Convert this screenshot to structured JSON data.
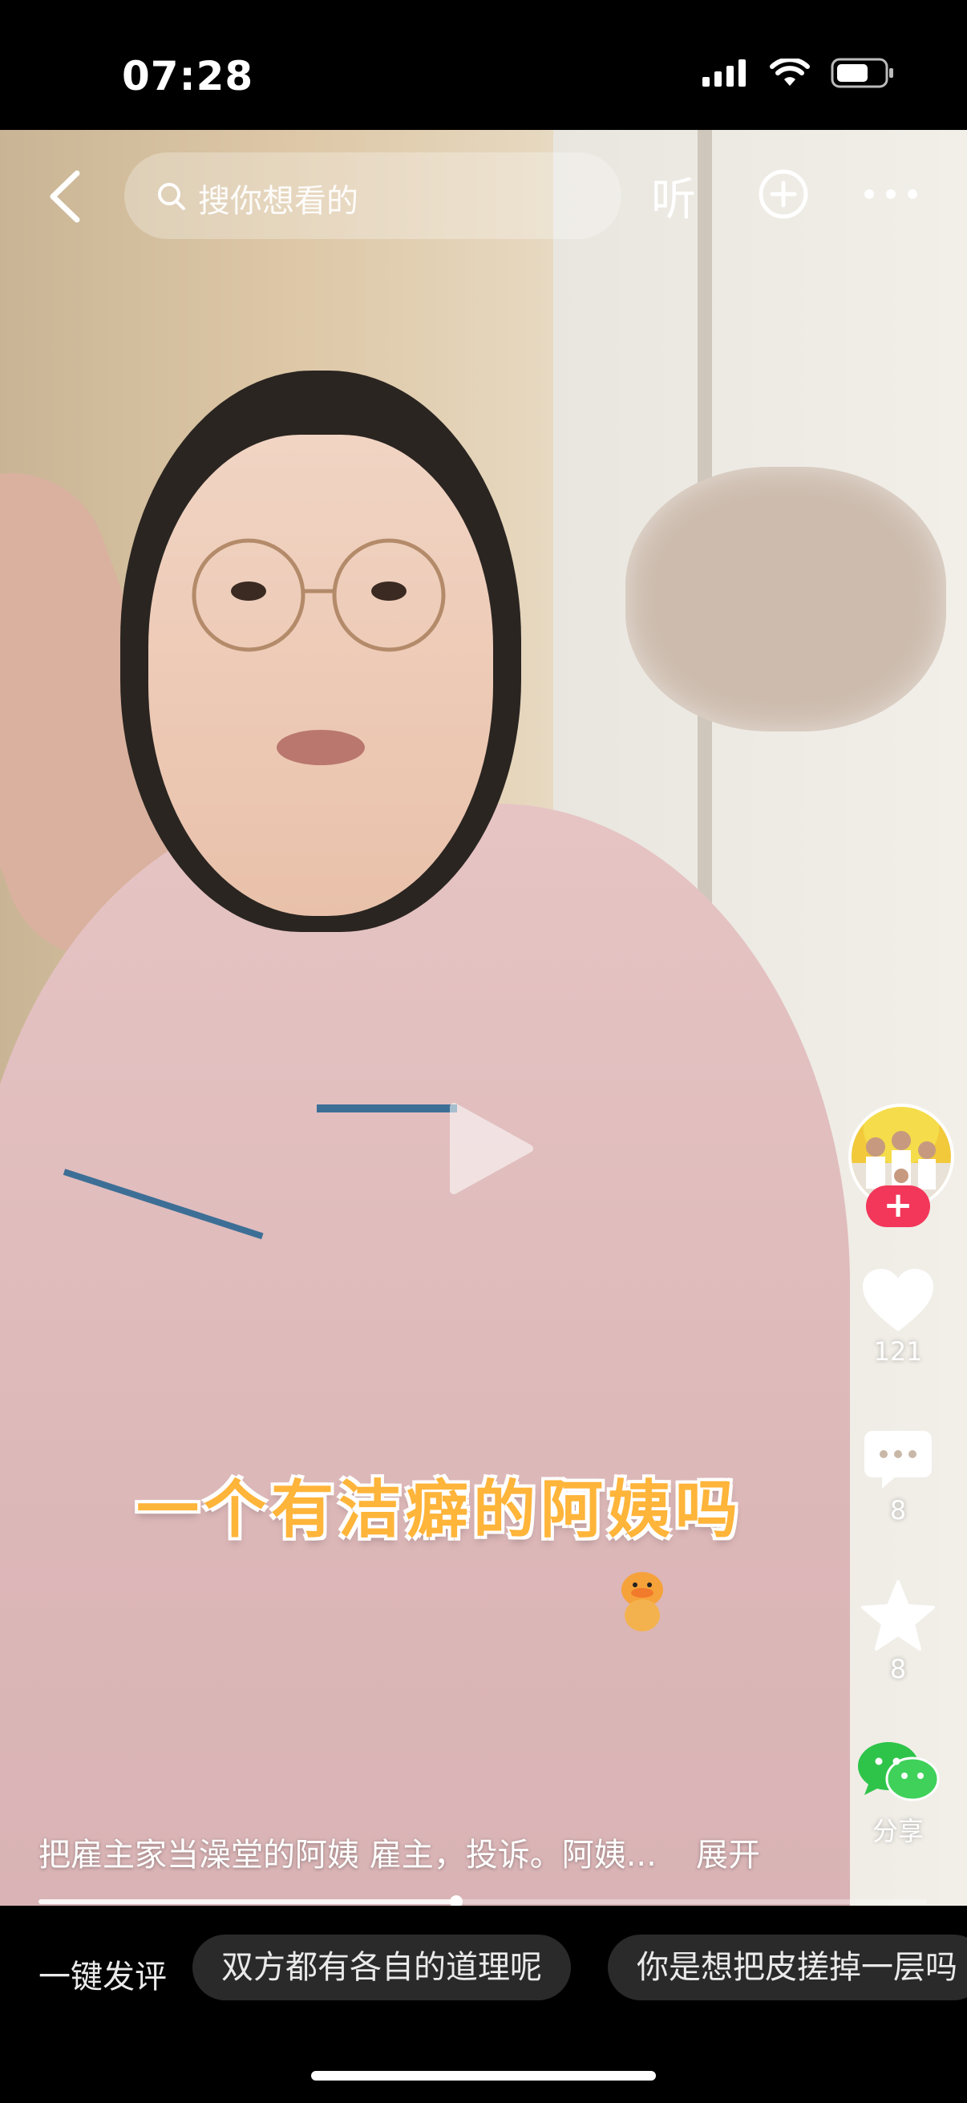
{
  "status_bar": {
    "time": "07:28"
  },
  "top_nav": {
    "search_placeholder": "搜你想看的",
    "listen_label": "听"
  },
  "video": {
    "caption_overlay": "一个有洁癖的阿姨吗",
    "description": "把雇主家当澡堂的阿姨 雇主，投诉。阿姨...",
    "expand_label": "展开",
    "progress": 0.47
  },
  "right_rail": {
    "follow_symbol": "+",
    "likes": "121",
    "comments": "8",
    "favorites": "8",
    "share_label": "分享"
  },
  "bottom_bar": {
    "quick_comment_label": "一键发评",
    "chips": [
      "双方都有各自的道理呢",
      "你是想把皮搓掉一层吗"
    ]
  },
  "colors": {
    "accent_red": "#f2375a",
    "caption_orange": "#ffb43a",
    "wechat_green": "#2ec44a"
  }
}
